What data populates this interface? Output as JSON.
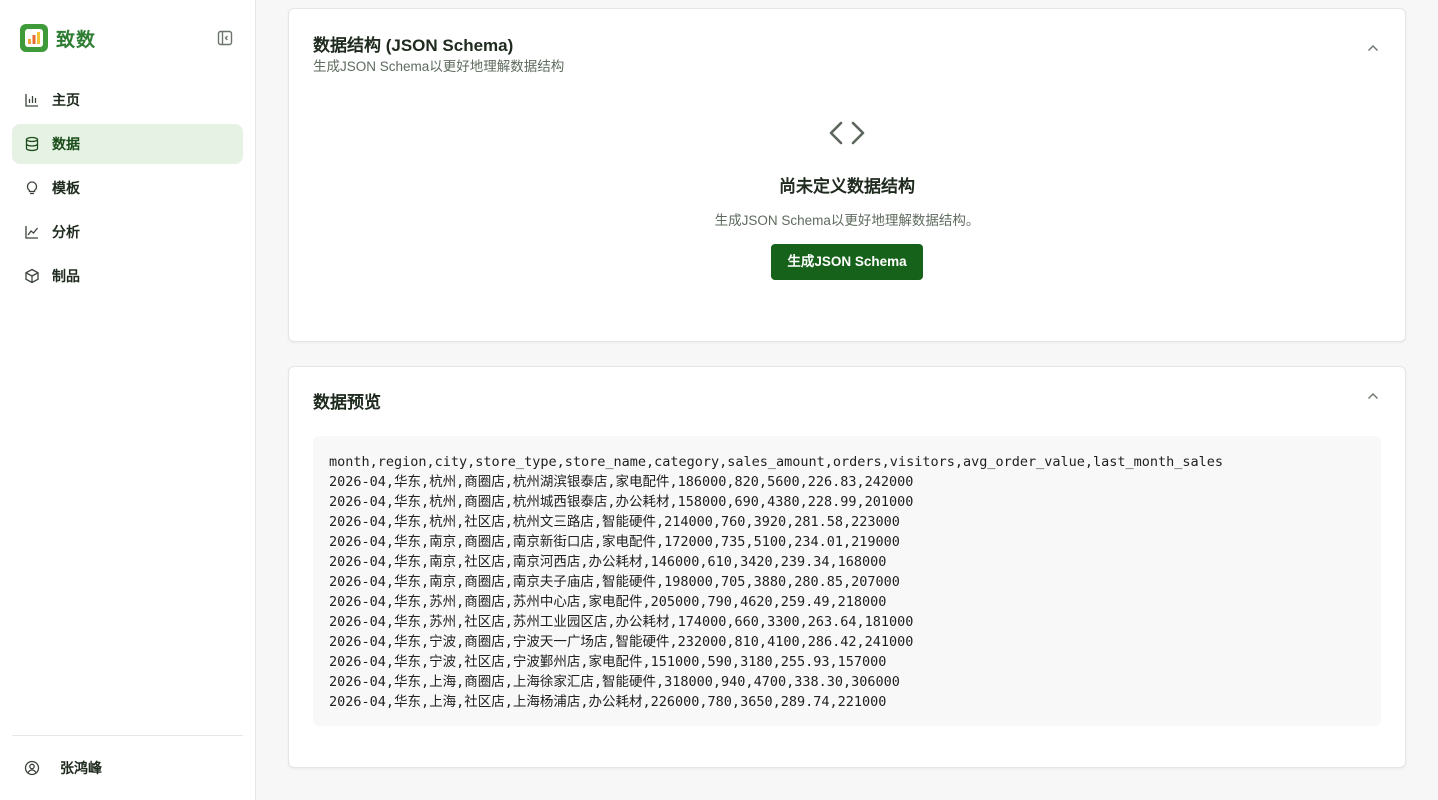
{
  "app": {
    "name": "致数"
  },
  "sidebar": {
    "items": [
      {
        "label": "主页",
        "icon": "bar-chart-icon",
        "active": false
      },
      {
        "label": "数据",
        "icon": "database-icon",
        "active": true
      },
      {
        "label": "模板",
        "icon": "lightbulb-icon",
        "active": false
      },
      {
        "label": "分析",
        "icon": "line-chart-icon",
        "active": false
      },
      {
        "label": "制品",
        "icon": "cube-icon",
        "active": false
      }
    ],
    "user": {
      "name": "张鸿峰",
      "icon": "user-circle-icon"
    }
  },
  "schema": {
    "title": "数据结构 (JSON Schema)",
    "subtitle": "生成JSON Schema以更好地理解数据结构",
    "empty_title": "尚未定义数据结构",
    "empty_desc": "生成JSON Schema以更好地理解数据结构。",
    "button": "生成JSON Schema"
  },
  "preview": {
    "title": "数据预览",
    "lines": [
      "month,region,city,store_type,store_name,category,sales_amount,orders,visitors,avg_order_value,last_month_sales",
      "2026-04,华东,杭州,商圈店,杭州湖滨银泰店,家电配件,186000,820,5600,226.83,242000",
      "2026-04,华东,杭州,商圈店,杭州城西银泰店,办公耗材,158000,690,4380,228.99,201000",
      "2026-04,华东,杭州,社区店,杭州文三路店,智能硬件,214000,760,3920,281.58,223000",
      "2026-04,华东,南京,商圈店,南京新街口店,家电配件,172000,735,5100,234.01,219000",
      "2026-04,华东,南京,社区店,南京河西店,办公耗材,146000,610,3420,239.34,168000",
      "2026-04,华东,南京,商圈店,南京夫子庙店,智能硬件,198000,705,3880,280.85,207000",
      "2026-04,华东,苏州,商圈店,苏州中心店,家电配件,205000,790,4620,259.49,218000",
      "2026-04,华东,苏州,社区店,苏州工业园区店,办公耗材,174000,660,3300,263.64,181000",
      "2026-04,华东,宁波,商圈店,宁波天一广场店,智能硬件,232000,810,4100,286.42,241000",
      "2026-04,华东,宁波,社区店,宁波鄞州店,家电配件,151000,590,3180,255.93,157000",
      "2026-04,华东,上海,商圈店,上海徐家汇店,智能硬件,318000,940,4700,338.30,306000",
      "2026-04,华东,上海,社区店,上海杨浦店,办公耗材,226000,780,3650,289.74,221000"
    ]
  },
  "colors": {
    "brand": "#2e7d32",
    "active_bg": "#e6f2e4",
    "button": "#17621a"
  }
}
